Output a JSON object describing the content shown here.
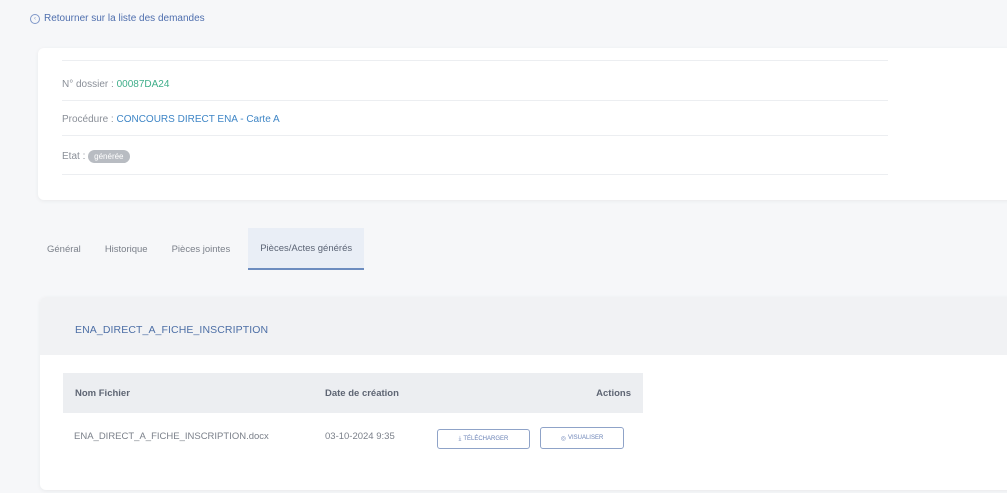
{
  "back_link": {
    "label": "Retourner sur la liste des demandes"
  },
  "dossier": {
    "numero_label": "N° dossier :",
    "numero_value": "00087DA24",
    "procedure_label": "Procédure :",
    "procedure_value": "CONCOURS DIRECT ENA - Carte A",
    "etat_label": "Etat :",
    "etat_value": "générée"
  },
  "tabs": [
    {
      "label": "Général"
    },
    {
      "label": "Historique"
    },
    {
      "label": "Pièces jointes"
    },
    {
      "label": "Pièces/Actes générés",
      "active": true
    }
  ],
  "section": {
    "title": "ENA_DIRECT_A_FICHE_INSCRIPTION",
    "columns": [
      "Nom Fichier",
      "Date de création",
      "Actions"
    ],
    "rows": [
      {
        "nom": "ENA_DIRECT_A_FICHE_INSCRIPTION.docx",
        "date": "03-10-2024 9:35",
        "actions": [
          "TÉLÉCHARGER",
          "VISUALISER"
        ]
      }
    ]
  },
  "colors": {
    "accent": "#4f6fae",
    "badge": "#b8bcc2",
    "number": "#3fae8a"
  }
}
